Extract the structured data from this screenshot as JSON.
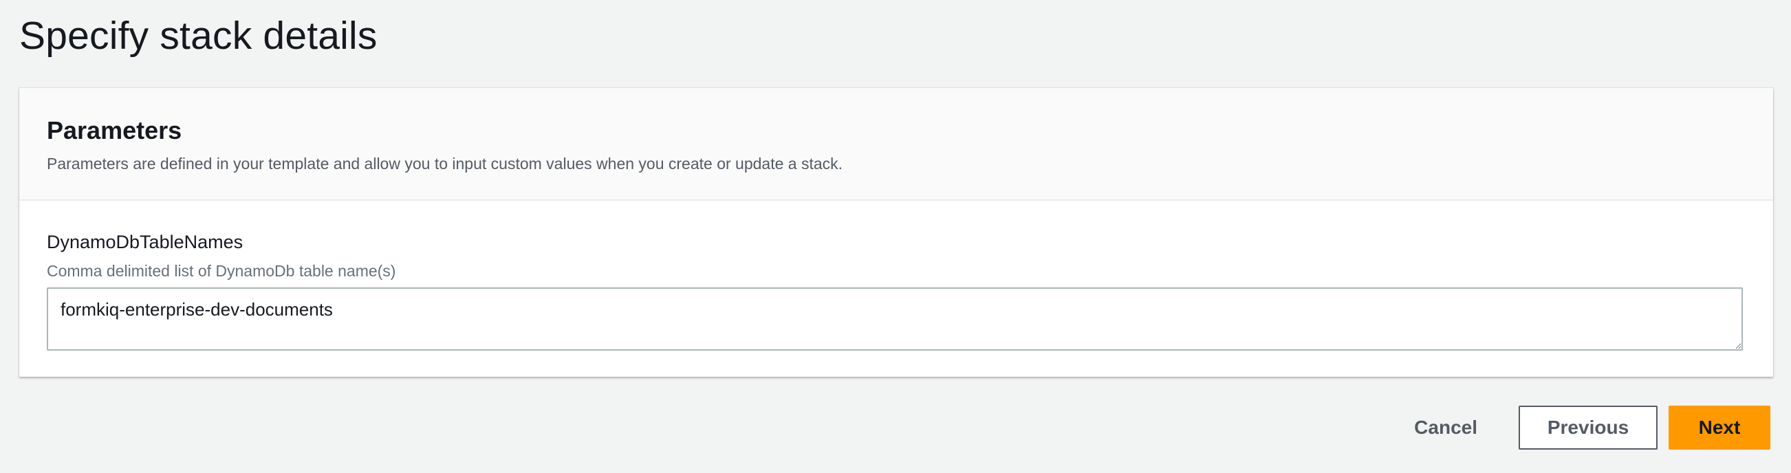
{
  "page": {
    "title": "Specify stack details"
  },
  "parameters": {
    "title": "Parameters",
    "description": "Parameters are defined in your template and allow you to input custom values when you create or update a stack.",
    "items": [
      {
        "label": "DynamoDbTableNames",
        "description": "Comma delimited list of DynamoDb table name(s)",
        "value": "formkiq-enterprise-dev-documents"
      }
    ]
  },
  "actions": {
    "cancel_label": "Cancel",
    "previous_label": "Previous",
    "next_label": "Next"
  },
  "colors": {
    "primary": "#ff9900",
    "background": "#f2f3f3",
    "text": "#16191f",
    "secondary_text": "#545b64"
  }
}
